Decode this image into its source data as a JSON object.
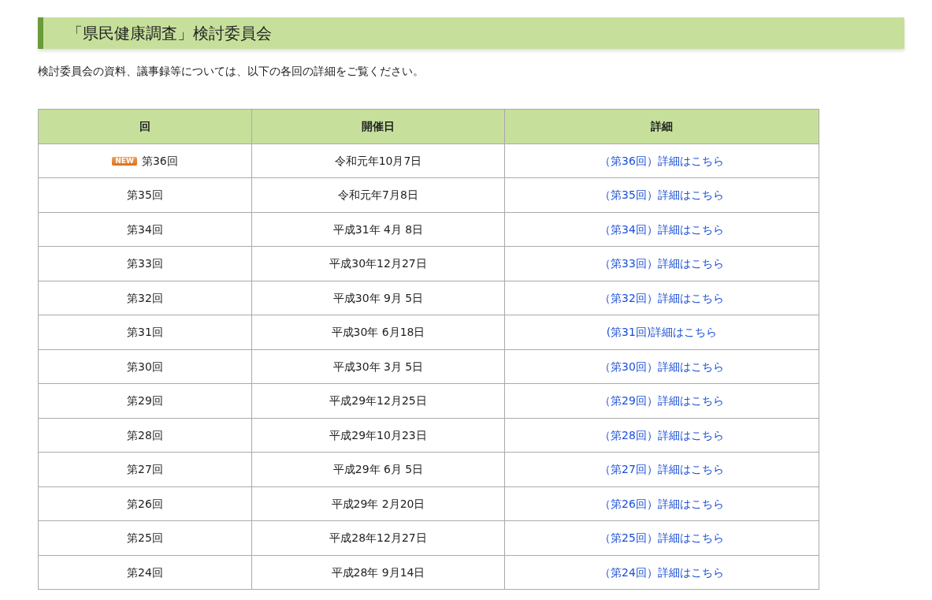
{
  "heading": "「県民健康調査」検討委員会",
  "intro": "検討委員会の資料、議事録等については、以下の各回の詳細をご覧ください。",
  "table": {
    "columns": [
      "回",
      "開催日",
      "詳細"
    ],
    "rows": [
      {
        "badge": "NEW",
        "session": "第36回",
        "date": "令和元年10月7日",
        "link": "（第36回）詳細はこちら"
      },
      {
        "session": "第35回",
        "date": "令和元年7月8日",
        "link": "（第35回）詳細はこちら"
      },
      {
        "session": "第34回",
        "date": "平成31年 4月 8日",
        "link": "（第34回）詳細はこちら"
      },
      {
        "session": "第33回",
        "date": "平成30年12月27日",
        "link": "（第33回）詳細はこちら"
      },
      {
        "session": "第32回",
        "date": "平成30年 9月 5日",
        "link": "（第32回）詳細はこちら"
      },
      {
        "session": "第31回",
        "date": "平成30年 6月18日",
        "link": "(第31回)詳細はこちら"
      },
      {
        "session": "第30回",
        "date": "平成30年 3月 5日",
        "link": "（第30回）詳細はこちら"
      },
      {
        "session": "第29回",
        "date": "平成29年12月25日",
        "link": "（第29回）詳細はこちら"
      },
      {
        "session": "第28回",
        "date": "平成29年10月23日",
        "link": "（第28回）詳細はこちら"
      },
      {
        "session": "第27回",
        "date": "平成29年 6月 5日",
        "link": "（第27回）詳細はこちら"
      },
      {
        "session": "第26回",
        "date": "平成29年 2月20日",
        "link": "（第26回）詳細はこちら"
      },
      {
        "session": "第25回",
        "date": "平成28年12月27日",
        "link": "（第25回）詳細はこちら"
      },
      {
        "session": "第24回",
        "date": "平成28年 9月14日",
        "link": "（第24回）詳細はこちら"
      }
    ]
  }
}
